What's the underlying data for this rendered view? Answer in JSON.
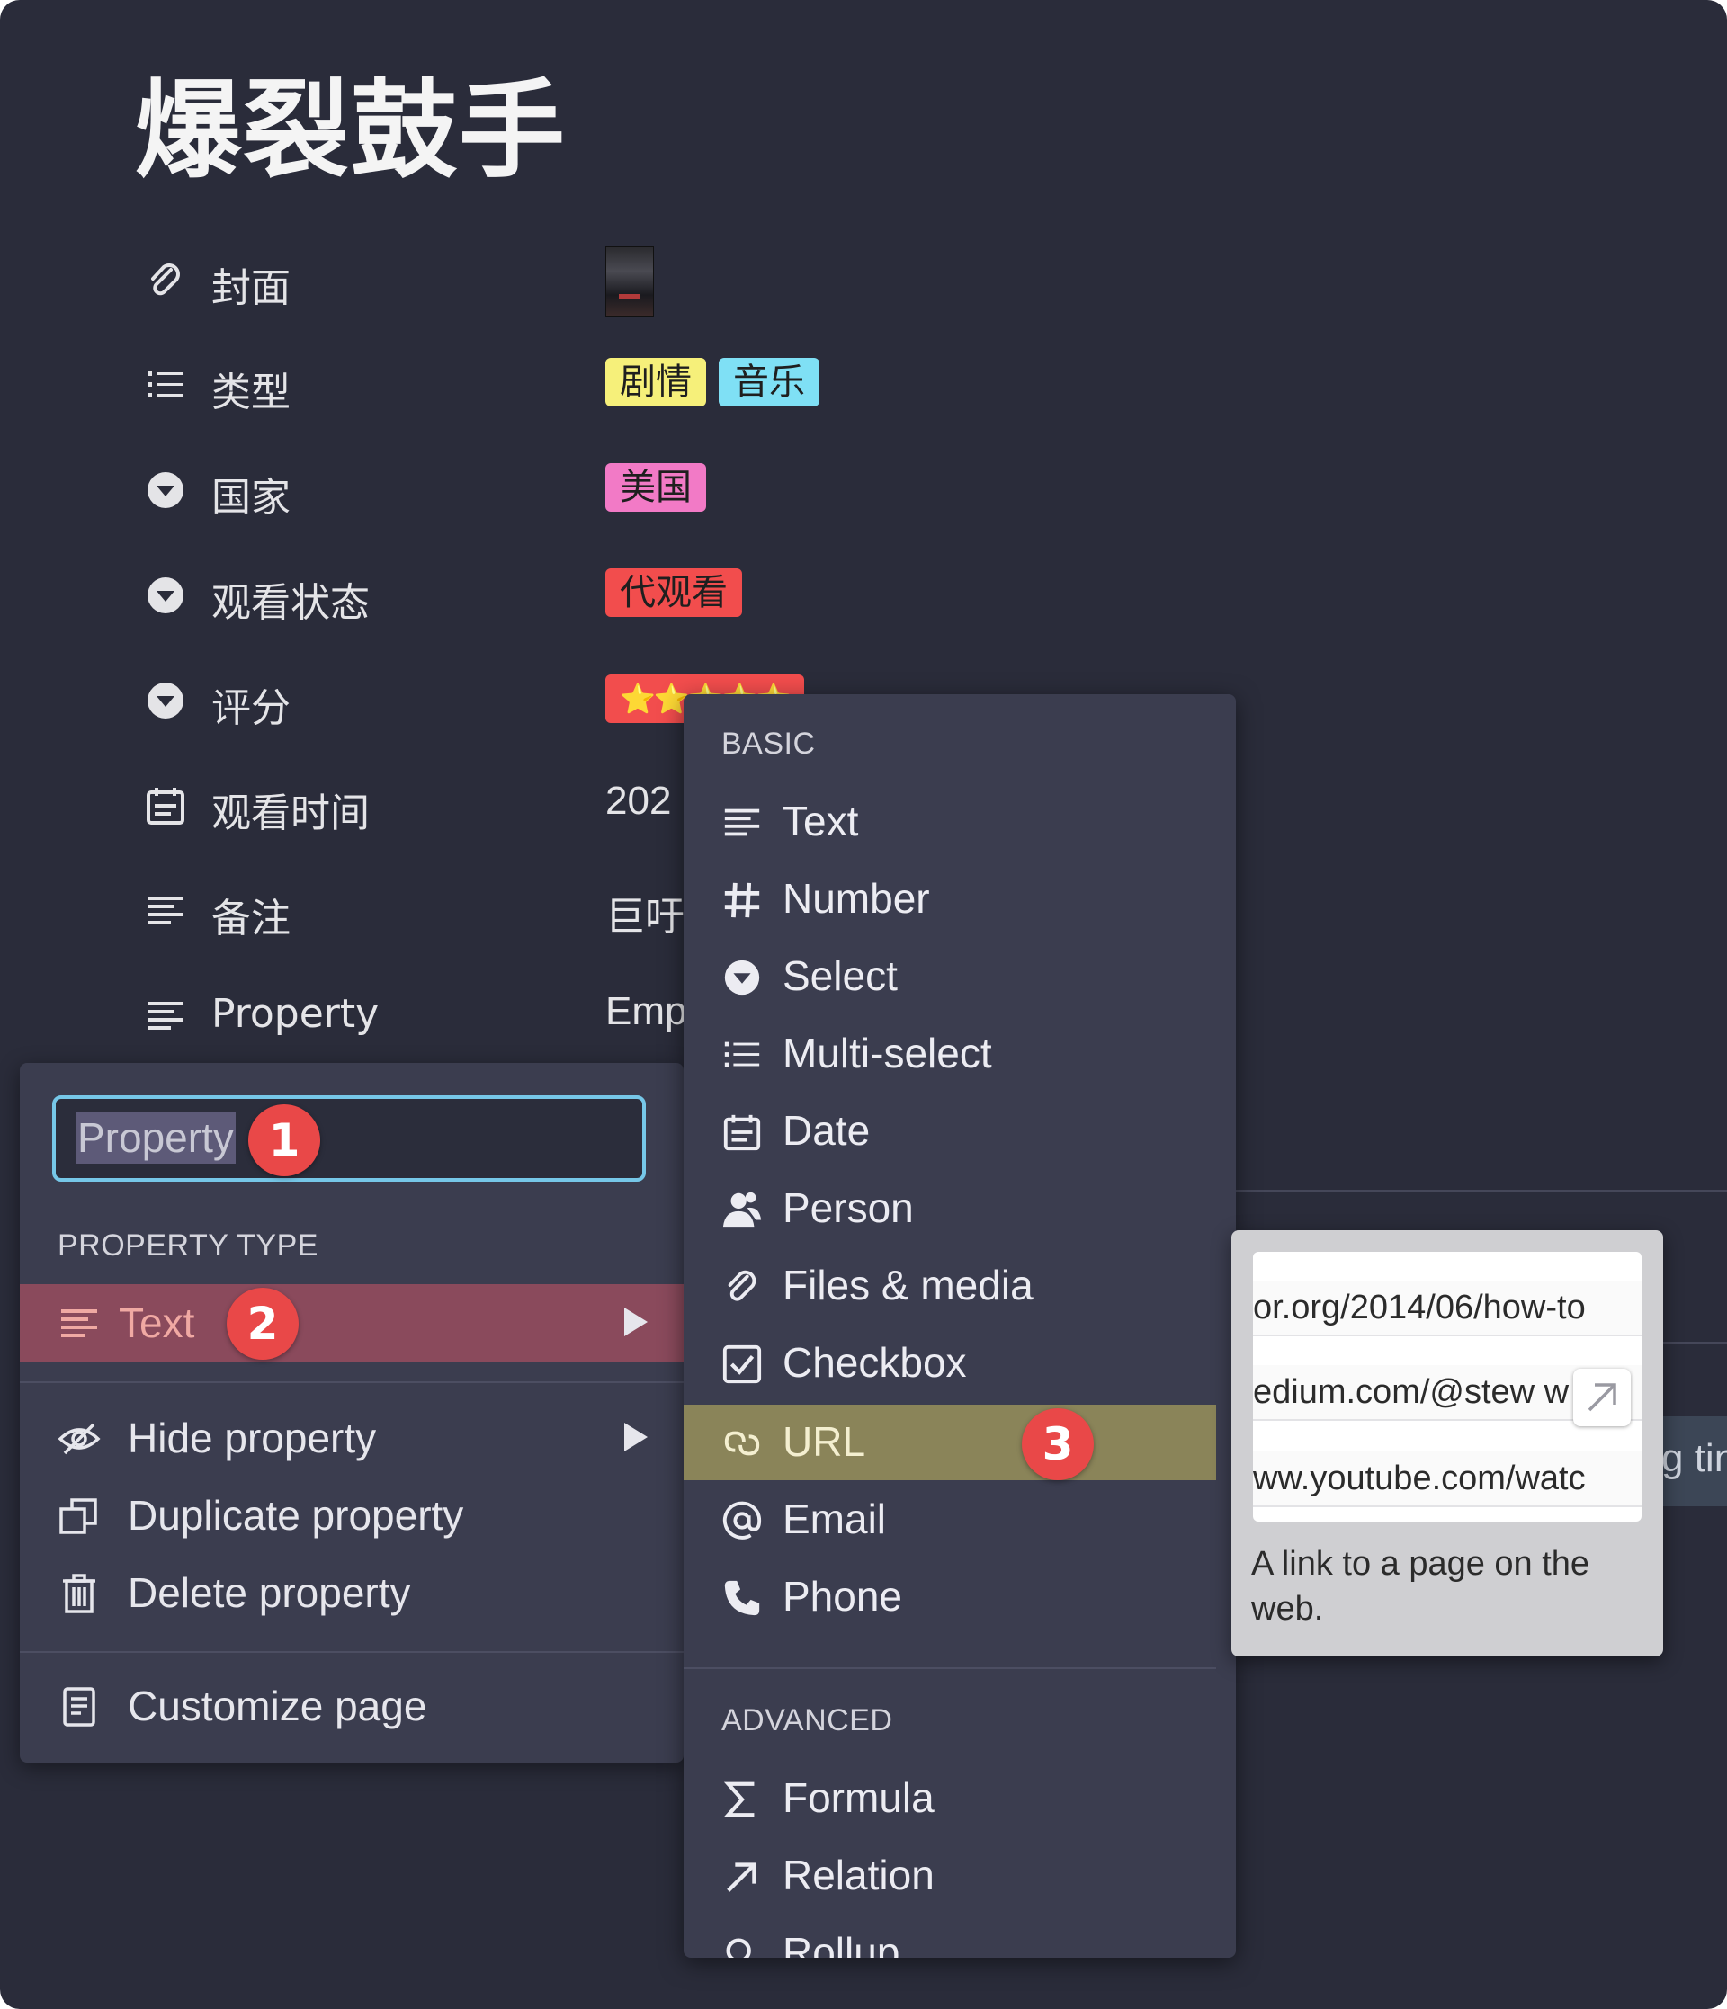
{
  "page": {
    "title": "爆裂鼓手"
  },
  "properties": [
    {
      "icon": "paperclip-icon",
      "name": "封面",
      "kind": "cover"
    },
    {
      "icon": "list-icon",
      "name": "类型",
      "kind": "tags",
      "tags": [
        {
          "text": "剧情",
          "color": "#f6f07a"
        },
        {
          "text": "音乐",
          "color": "#7fe0f5"
        }
      ]
    },
    {
      "icon": "select-icon",
      "name": "国家",
      "kind": "tags",
      "tags": [
        {
          "text": "美国",
          "color": "#f27ac6"
        }
      ]
    },
    {
      "icon": "select-icon",
      "name": "观看状态",
      "kind": "tags",
      "tags": [
        {
          "text": "代观看",
          "color": "#f24d4d"
        }
      ]
    },
    {
      "icon": "select-icon",
      "name": "评分",
      "kind": "tags",
      "tags": [
        {
          "text": "⭐⭐⭐⭐⭐",
          "color": "#f24d4d"
        }
      ]
    },
    {
      "icon": "calendar-icon",
      "name": "观看时间",
      "kind": "text",
      "value": "202"
    },
    {
      "icon": "text-icon",
      "name": "备注",
      "kind": "text",
      "value": "巨吁"
    },
    {
      "icon": "text-icon",
      "name": "Property",
      "kind": "text",
      "value": "Emp"
    }
  ],
  "property_menu": {
    "name_input": "Property",
    "section_label": "PROPERTY TYPE",
    "type_row_label": "Text",
    "actions": [
      {
        "label": "Hide property",
        "icon": "eye-slash-icon",
        "submenu": true
      },
      {
        "label": "Duplicate property",
        "icon": "duplicate-icon",
        "submenu": false
      },
      {
        "label": "Delete property",
        "icon": "trash-icon",
        "submenu": false
      }
    ],
    "customize_label": "Customize page"
  },
  "type_menu": {
    "basic_label": "BASIC",
    "basic": [
      {
        "label": "Text",
        "icon": "text-icon"
      },
      {
        "label": "Number",
        "icon": "hash-icon"
      },
      {
        "label": "Select",
        "icon": "select-icon"
      },
      {
        "label": "Multi-select",
        "icon": "list-icon"
      },
      {
        "label": "Date",
        "icon": "calendar-icon"
      },
      {
        "label": "Person",
        "icon": "person-icon"
      },
      {
        "label": "Files & media",
        "icon": "paperclip-icon"
      },
      {
        "label": "Checkbox",
        "icon": "checkbox-icon"
      },
      {
        "label": "URL",
        "icon": "link-icon",
        "selected": true
      },
      {
        "label": "Email",
        "icon": "at-icon"
      },
      {
        "label": "Phone",
        "icon": "phone-icon"
      }
    ],
    "advanced_label": "ADVANCED",
    "advanced": [
      {
        "label": "Formula",
        "icon": "sigma-icon"
      },
      {
        "label": "Relation",
        "icon": "arrow-up-right-icon"
      },
      {
        "label": "Rollup",
        "icon": "search-icon"
      }
    ]
  },
  "preview": {
    "urls": [
      "or.org/2014/06/how-to",
      "edium.com/@stew  w",
      "ww.youtube.com/watc"
    ],
    "description": "A link to a page on the web."
  },
  "background": {
    "partial_text": "g tin"
  },
  "badges": {
    "one": "1",
    "two": "2",
    "three": "3"
  }
}
